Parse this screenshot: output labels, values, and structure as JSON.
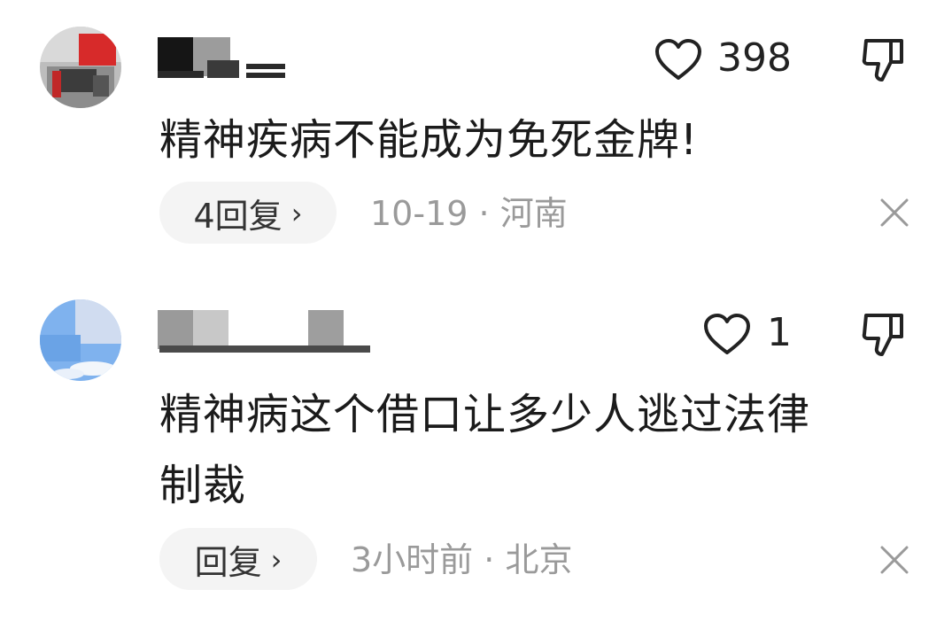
{
  "comments": [
    {
      "likes": "398",
      "text": "精神疾病不能成为免死金牌!",
      "reply_label": "4回复",
      "date": "10-19",
      "location": "河南",
      "separator": "·"
    },
    {
      "likes": "1",
      "text_line1": "精神病这个借口让多少人逃过法律",
      "text_line2": "制裁",
      "reply_label": "回复",
      "date": "3小时前",
      "location": "北京",
      "separator": "·"
    }
  ],
  "icons": {
    "like": "heart-outline-icon",
    "dislike": "thumbs-down-icon",
    "close": "close-icon",
    "chevron": "chevron-right-icon"
  },
  "colors": {
    "text": "#1b1b1b",
    "meta": "#9a9a9a",
    "reply_bg": "#f4f4f4"
  }
}
